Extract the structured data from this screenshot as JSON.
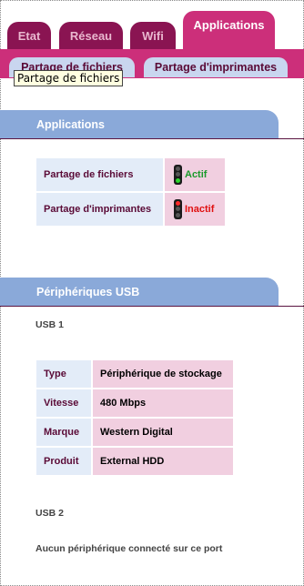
{
  "tabs": [
    {
      "label": "Etat"
    },
    {
      "label": "Réseau"
    },
    {
      "label": "Wifi"
    },
    {
      "label": "Applications"
    }
  ],
  "subtabs": [
    {
      "label": "Partage de fichiers"
    },
    {
      "label": "Partage d'imprimantes"
    }
  ],
  "tooltip": "Partage de fichiers",
  "applications": {
    "title": "Applications",
    "rows": [
      {
        "label": "Partage de fichiers",
        "status": "Actif"
      },
      {
        "label": "Partage d'imprimantes",
        "status": "Inactif"
      }
    ]
  },
  "usb": {
    "title": "Périphériques USB",
    "usb1": {
      "title": "USB 1",
      "rows": [
        {
          "label": "Type",
          "value": "Périphérique de stockage"
        },
        {
          "label": "Vitesse",
          "value": "480 Mbps"
        },
        {
          "label": "Marque",
          "value": "Western Digital"
        },
        {
          "label": "Produit",
          "value": "External HDD"
        }
      ]
    },
    "usb2": {
      "title": "USB 2",
      "message": "Aucun périphérique connecté sur ce port"
    }
  },
  "colors": {
    "tab_dark": "#8a1452",
    "tab_active": "#cc2f7a",
    "section_blue": "#8aa9d9",
    "active_green": "#1a9a2a",
    "inactive_red": "#e01010"
  }
}
